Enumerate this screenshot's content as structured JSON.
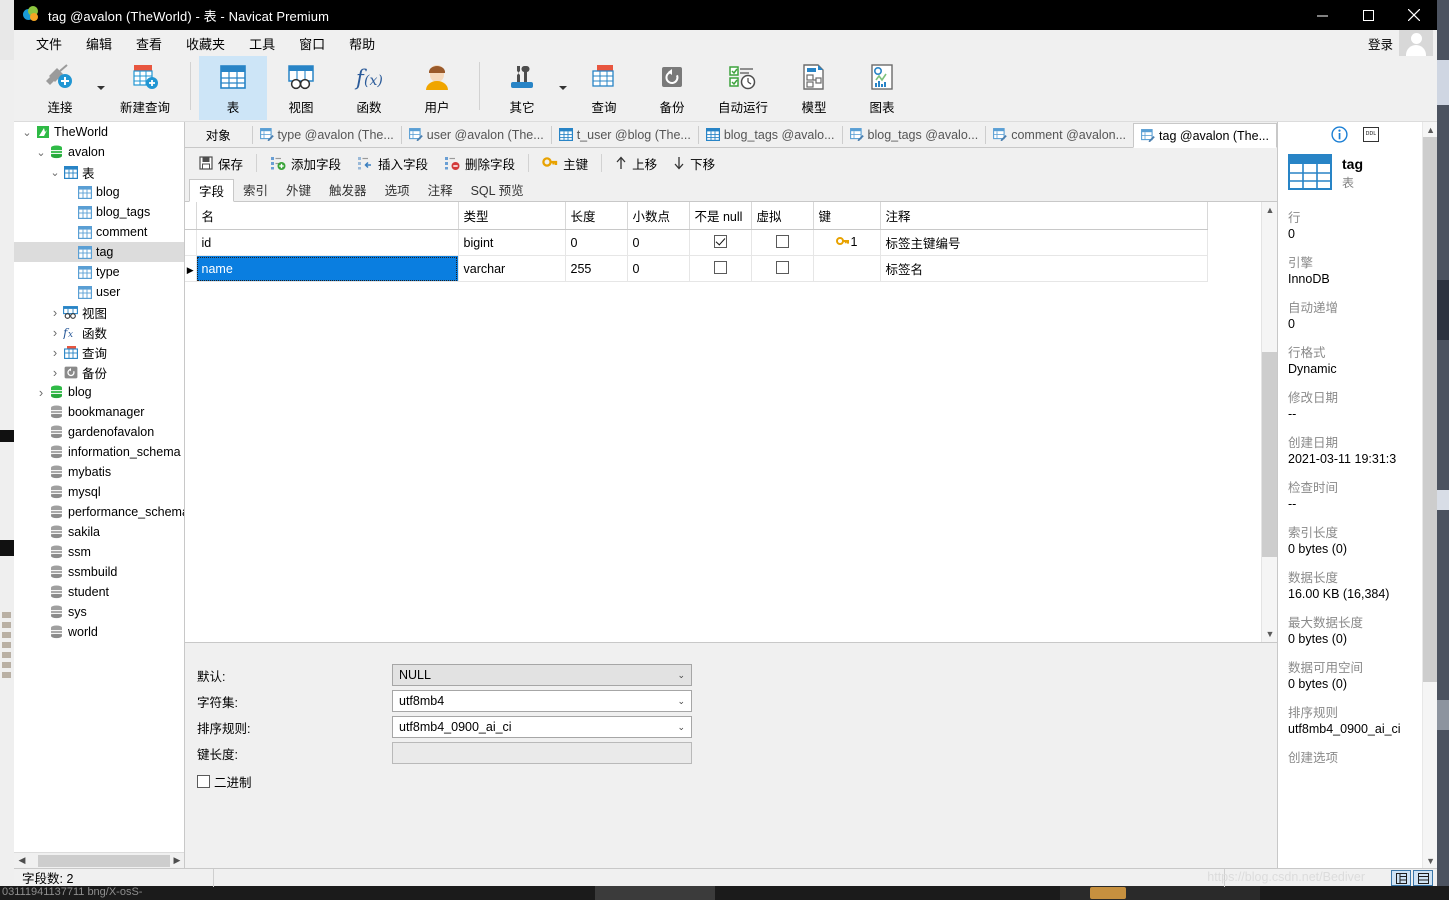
{
  "window": {
    "title": "tag @avalon (TheWorld) - 表 - Navicat Premium",
    "minimize_label": "minimize",
    "maximize_label": "maximize",
    "close_label": "close"
  },
  "menubar": {
    "items": [
      "文件",
      "编辑",
      "查看",
      "收藏夹",
      "工具",
      "窗口",
      "帮助"
    ],
    "login_label": "登录"
  },
  "ribbon": {
    "items": [
      {
        "label": "连接",
        "icon": "connection-icon",
        "has_caret": true
      },
      {
        "label": "新建查询",
        "icon": "new-query-icon",
        "has_caret": false
      },
      {
        "label": "表",
        "icon": "table-icon",
        "active": true
      },
      {
        "label": "视图",
        "icon": "view-icon",
        "active": false
      },
      {
        "label": "函数",
        "icon": "function-icon",
        "active": false
      },
      {
        "label": "用户",
        "icon": "user-icon",
        "active": false
      },
      {
        "label": "其它",
        "icon": "other-icon",
        "has_caret": true
      },
      {
        "label": "查询",
        "icon": "query-icon"
      },
      {
        "label": "备份",
        "icon": "backup-icon"
      },
      {
        "label": "自动运行",
        "icon": "automation-icon"
      },
      {
        "label": "模型",
        "icon": "model-icon"
      },
      {
        "label": "图表",
        "icon": "chart-icon"
      }
    ]
  },
  "sidebar": {
    "nodes": [
      {
        "label": "TheWorld",
        "indent": 0,
        "expander": "down",
        "icon": "connection-node-icon",
        "selected": false
      },
      {
        "label": "avalon",
        "indent": 1,
        "expander": "down",
        "icon": "database-green-icon",
        "selected": false
      },
      {
        "label": "表",
        "indent": 2,
        "expander": "down",
        "icon": "tables-folder-icon",
        "selected": false
      },
      {
        "label": "blog",
        "indent": 3,
        "expander": "none",
        "icon": "table-node-icon",
        "selected": false
      },
      {
        "label": "blog_tags",
        "indent": 3,
        "expander": "none",
        "icon": "table-node-icon",
        "selected": false
      },
      {
        "label": "comment",
        "indent": 3,
        "expander": "none",
        "icon": "table-node-icon",
        "selected": false
      },
      {
        "label": "tag",
        "indent": 3,
        "expander": "none",
        "icon": "table-node-icon",
        "selected": true
      },
      {
        "label": "type",
        "indent": 3,
        "expander": "none",
        "icon": "table-node-icon",
        "selected": false
      },
      {
        "label": "user",
        "indent": 3,
        "expander": "none",
        "icon": "table-node-icon",
        "selected": false
      },
      {
        "label": "视图",
        "indent": 2,
        "expander": "right",
        "icon": "views-folder-icon",
        "selected": false
      },
      {
        "label": "函数",
        "indent": 2,
        "expander": "right",
        "icon": "functions-folder-icon",
        "selected": false
      },
      {
        "label": "查询",
        "indent": 2,
        "expander": "right",
        "icon": "queries-folder-icon",
        "selected": false
      },
      {
        "label": "备份",
        "indent": 2,
        "expander": "right",
        "icon": "backups-folder-icon",
        "selected": false
      },
      {
        "label": "blog",
        "indent": 1,
        "expander": "right",
        "icon": "database-green-icon",
        "selected": false
      },
      {
        "label": "bookmanager",
        "indent": 1,
        "expander": "none",
        "icon": "database-grey-icon",
        "selected": false
      },
      {
        "label": "gardenofavalon",
        "indent": 1,
        "expander": "none",
        "icon": "database-grey-icon",
        "selected": false
      },
      {
        "label": "information_schema",
        "indent": 1,
        "expander": "none",
        "icon": "database-grey-icon",
        "selected": false
      },
      {
        "label": "mybatis",
        "indent": 1,
        "expander": "none",
        "icon": "database-grey-icon",
        "selected": false
      },
      {
        "label": "mysql",
        "indent": 1,
        "expander": "none",
        "icon": "database-grey-icon",
        "selected": false
      },
      {
        "label": "performance_schema",
        "indent": 1,
        "expander": "none",
        "icon": "database-grey-icon",
        "selected": false
      },
      {
        "label": "sakila",
        "indent": 1,
        "expander": "none",
        "icon": "database-grey-icon",
        "selected": false
      },
      {
        "label": "ssm",
        "indent": 1,
        "expander": "none",
        "icon": "database-grey-icon",
        "selected": false
      },
      {
        "label": "ssmbuild",
        "indent": 1,
        "expander": "none",
        "icon": "database-grey-icon",
        "selected": false
      },
      {
        "label": "student",
        "indent": 1,
        "expander": "none",
        "icon": "database-grey-icon",
        "selected": false
      },
      {
        "label": "sys",
        "indent": 1,
        "expander": "none",
        "icon": "database-grey-icon",
        "selected": false
      },
      {
        "label": "world",
        "indent": 1,
        "expander": "none",
        "icon": "database-grey-icon",
        "selected": false
      }
    ]
  },
  "tabbar": {
    "object_button": "对象",
    "tabs": [
      {
        "label": "type @avalon (The...",
        "icon": "table-design-icon",
        "active": false
      },
      {
        "label": "user @avalon (The...",
        "icon": "table-design-icon",
        "active": false
      },
      {
        "label": "t_user @blog (The...",
        "icon": "table-data-icon",
        "active": false
      },
      {
        "label": "blog_tags @avalo...",
        "icon": "table-data-icon",
        "active": false
      },
      {
        "label": "blog_tags @avalo...",
        "icon": "table-design-icon",
        "active": false
      },
      {
        "label": "comment @avalon...",
        "icon": "table-design-icon",
        "active": false
      },
      {
        "label": "tag @avalon (The...",
        "icon": "table-design-icon",
        "active": true
      }
    ]
  },
  "toolbar": {
    "items": [
      {
        "label": "保存",
        "icon": "save-icon"
      },
      {
        "label": "添加字段",
        "icon": "add-field-icon"
      },
      {
        "label": "插入字段",
        "icon": "insert-field-icon"
      },
      {
        "label": "删除字段",
        "icon": "delete-field-icon"
      },
      {
        "label": "主键",
        "icon": "primary-key-icon"
      },
      {
        "label": "上移",
        "icon": "move-up-icon"
      },
      {
        "label": "下移",
        "icon": "move-down-icon"
      }
    ]
  },
  "subtabs": {
    "items": [
      "字段",
      "索引",
      "外键",
      "触发器",
      "选项",
      "注释",
      "SQL 预览"
    ],
    "active_index": 0
  },
  "grid": {
    "columns": [
      "名",
      "类型",
      "长度",
      "小数点",
      "不是 null",
      "虚拟",
      "键",
      "注释"
    ],
    "rows": [
      {
        "name": "id",
        "type": "bigint",
        "length": "0",
        "decimals": "0",
        "not_null": true,
        "virtual": false,
        "key": "1",
        "comment": "标签主键编号",
        "selected": false,
        "current": false
      },
      {
        "name": "name",
        "type": "varchar",
        "length": "255",
        "decimals": "0",
        "not_null": false,
        "virtual": false,
        "key": "",
        "comment": "标签名",
        "selected": true,
        "current": true
      }
    ]
  },
  "form": {
    "rows": [
      {
        "label": "默认:",
        "value": "NULL",
        "type": "combo",
        "state": "grey"
      },
      {
        "label": "字符集:",
        "value": "utf8mb4",
        "type": "combo",
        "state": "normal"
      },
      {
        "label": "排序规则:",
        "value": "utf8mb4_0900_ai_ci",
        "type": "combo",
        "state": "normal"
      },
      {
        "label": "键长度:",
        "value": "",
        "type": "text",
        "state": "disabled"
      }
    ],
    "binary_checkbox": {
      "label": "二进制",
      "checked": false
    }
  },
  "info_panel": {
    "info_icon": "info-icon",
    "ddl_icon": "ddl-icon",
    "ddl_label": "DDL",
    "object_name": "tag",
    "object_type": "表",
    "properties": [
      {
        "key": "行",
        "value": "0"
      },
      {
        "key": "引擎",
        "value": "InnoDB"
      },
      {
        "key": "自动递增",
        "value": "0"
      },
      {
        "key": "行格式",
        "value": "Dynamic"
      },
      {
        "key": "修改日期",
        "value": "--"
      },
      {
        "key": "创建日期",
        "value": "2021-03-11 19:31:3"
      },
      {
        "key": "检查时间",
        "value": "--"
      },
      {
        "key": "索引长度",
        "value": "0 bytes (0)"
      },
      {
        "key": "数据长度",
        "value": "16.00 KB (16,384)"
      },
      {
        "key": "最大数据长度",
        "value": "0 bytes (0)"
      },
      {
        "key": "数据可用空间",
        "value": "0 bytes (0)"
      },
      {
        "key": "排序规则",
        "value": "utf8mb4_0900_ai_ci"
      },
      {
        "key": "创建选项",
        "value": ""
      }
    ]
  },
  "statusbar": {
    "field_count": "字段数: 2",
    "watermark": "https://blog.csdn.net/Bediver",
    "view_buttons": [
      "grid-view-button",
      "form-view-button"
    ]
  },
  "desktop": {
    "bottom_text_left": "03111941137711 bng/X-osS-"
  },
  "colors": {
    "accent": "#0a7ee0",
    "ribbon_active": "#cde5f7",
    "titlebar_bg": "#000000",
    "chrome_bg": "#f0f0f0",
    "key_icon": "#e8a200"
  }
}
